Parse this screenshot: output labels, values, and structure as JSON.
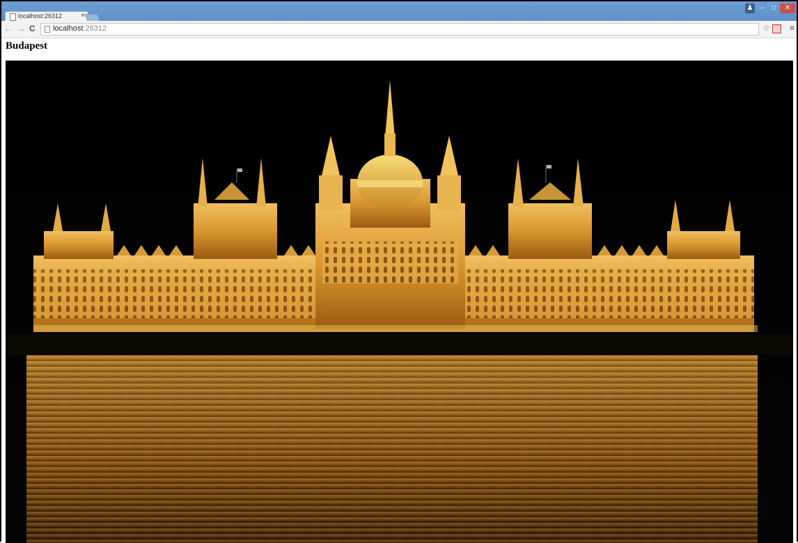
{
  "browser": {
    "tab_title": "localhost:26312",
    "tab_close": "×",
    "url_host": "localhost",
    "url_port": ":26312",
    "nav_back": "←",
    "nav_forward": "→",
    "nav_reload": "C",
    "star": "☆",
    "menu": "≡",
    "win_user": "♟",
    "win_min": "–",
    "win_max": "□",
    "win_close": "✕"
  },
  "page": {
    "heading": "Budapest",
    "image_alt": "Hungarian Parliament Building at night"
  }
}
